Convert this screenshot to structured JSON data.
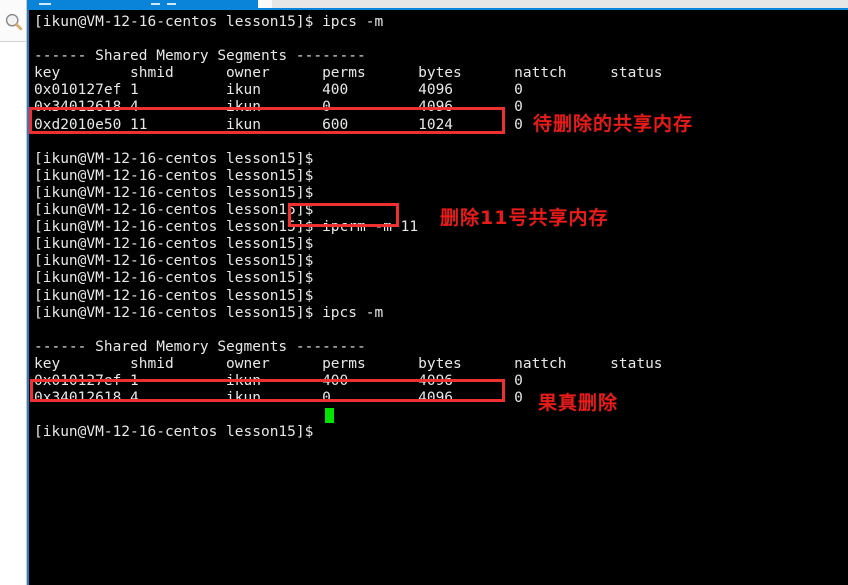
{
  "window": {
    "taskbar_color": "#0a84d8",
    "terminal_bg": "#000000",
    "terminal_fg": "#e8e8e8",
    "annotation_color": "#e81b1b",
    "box_color": "#f03030",
    "cursor_color": "#00e500"
  },
  "sidebar": {
    "search_icon": "search-icon"
  },
  "terminal": {
    "prompt": "[ikun@VM-12-16-centos lesson15]$",
    "lines": [
      "[ikun@VM-12-16-centos lesson15]$ ipcs -m",
      "",
      "------ Shared Memory Segments --------",
      "key        shmid      owner      perms      bytes      nattch     status",
      "0x010127ef 1          ikun       400        4096       0",
      "0x34012618 4          ikun       0          4096       0",
      "0xd2010e50 11         ikun       600        1024       0",
      "",
      "[ikun@VM-12-16-centos lesson15]$",
      "[ikun@VM-12-16-centos lesson15]$",
      "[ikun@VM-12-16-centos lesson15]$",
      "[ikun@VM-12-16-centos lesson15]$",
      "[ikun@VM-12-16-centos lesson15]$ ipcrm -m 11",
      "[ikun@VM-12-16-centos lesson15]$",
      "[ikun@VM-12-16-centos lesson15]$",
      "[ikun@VM-12-16-centos lesson15]$",
      "[ikun@VM-12-16-centos lesson15]$",
      "[ikun@VM-12-16-centos lesson15]$ ipcs -m",
      "",
      "------ Shared Memory Segments --------",
      "key        shmid      owner      perms      bytes      nattch     status",
      "0x010127ef 1          ikun       400        4096       0",
      "0x34012618 4          ikun       0          4096       0",
      "",
      "[ikun@VM-12-16-centos lesson15]$"
    ],
    "commands": {
      "ipcs": "ipcs -m",
      "ipcrm": "ipcrm -m 11"
    },
    "section_header": "------ Shared Memory Segments --------",
    "table_headers": [
      "key",
      "shmid",
      "owner",
      "perms",
      "bytes",
      "nattch",
      "status"
    ],
    "table_first": [
      {
        "key": "0x010127ef",
        "shmid": "1",
        "owner": "ikun",
        "perms": "400",
        "bytes": "4096",
        "nattch": "0",
        "status": ""
      },
      {
        "key": "0x34012618",
        "shmid": "4",
        "owner": "ikun",
        "perms": "0",
        "bytes": "4096",
        "nattch": "0",
        "status": ""
      },
      {
        "key": "0xd2010e50",
        "shmid": "11",
        "owner": "ikun",
        "perms": "600",
        "bytes": "1024",
        "nattch": "0",
        "status": ""
      }
    ],
    "table_second": [
      {
        "key": "0x010127ef",
        "shmid": "1",
        "owner": "ikun",
        "perms": "400",
        "bytes": "4096",
        "nattch": "0",
        "status": ""
      },
      {
        "key": "0x34012618",
        "shmid": "4",
        "owner": "ikun",
        "perms": "0",
        "bytes": "4096",
        "nattch": "0",
        "status": ""
      }
    ]
  },
  "annotations": {
    "pending": "待删除的共享内存",
    "delete": "删除11号共享内存",
    "gone": "果真删除"
  }
}
